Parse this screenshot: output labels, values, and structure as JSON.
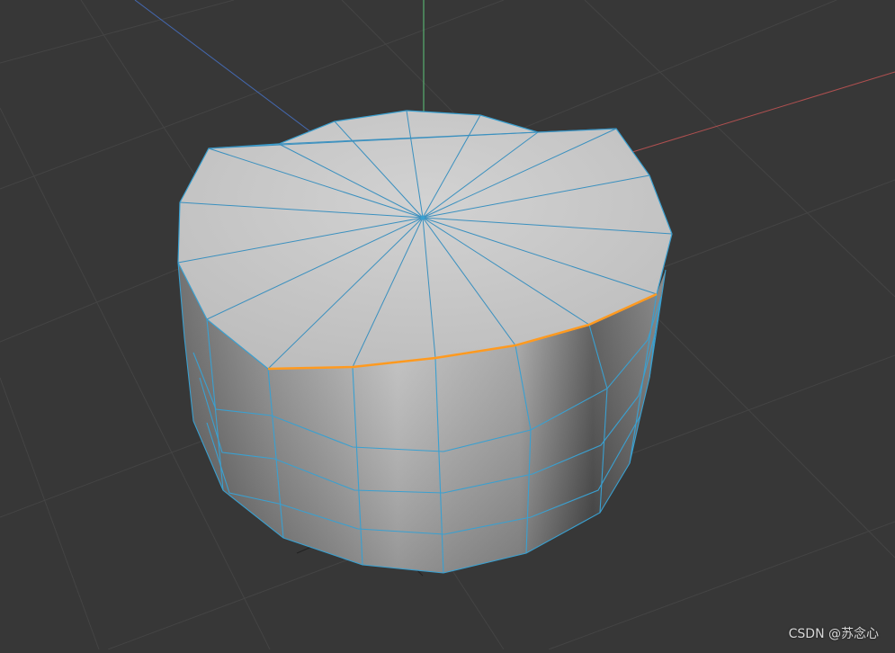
{
  "viewport": {
    "background": "#373737",
    "grid_color": "#454545",
    "axis_colors": {
      "x": "#c85a5a",
      "y": "#5ec47a",
      "z": "#4f78c8"
    },
    "mesh": {
      "object": "cylinder",
      "face_color": "#c8c8c8",
      "wire_color": "#3aa0d0",
      "selected_edge_color": "#ff9a20",
      "top_segments": 18,
      "side_rings": 3
    }
  },
  "watermark": {
    "text": "CSDN @苏念心"
  }
}
